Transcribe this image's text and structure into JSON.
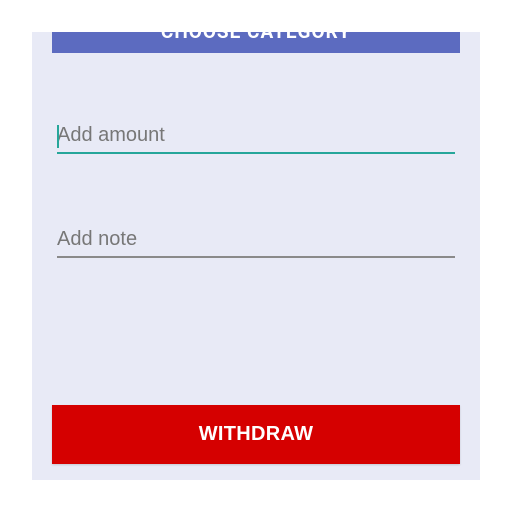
{
  "category_button": {
    "label": "CHOOSE CATEGORY"
  },
  "amount_field": {
    "placeholder": "Add amount",
    "value": "",
    "focused": true,
    "accent_color": "#26a69a"
  },
  "note_field": {
    "placeholder": "Add note",
    "value": ""
  },
  "withdraw_button": {
    "label": "WITHDRAW",
    "color": "#d50000"
  },
  "colors": {
    "screen_background": "#e8eaf6",
    "category_button": "#5c6bc0"
  }
}
